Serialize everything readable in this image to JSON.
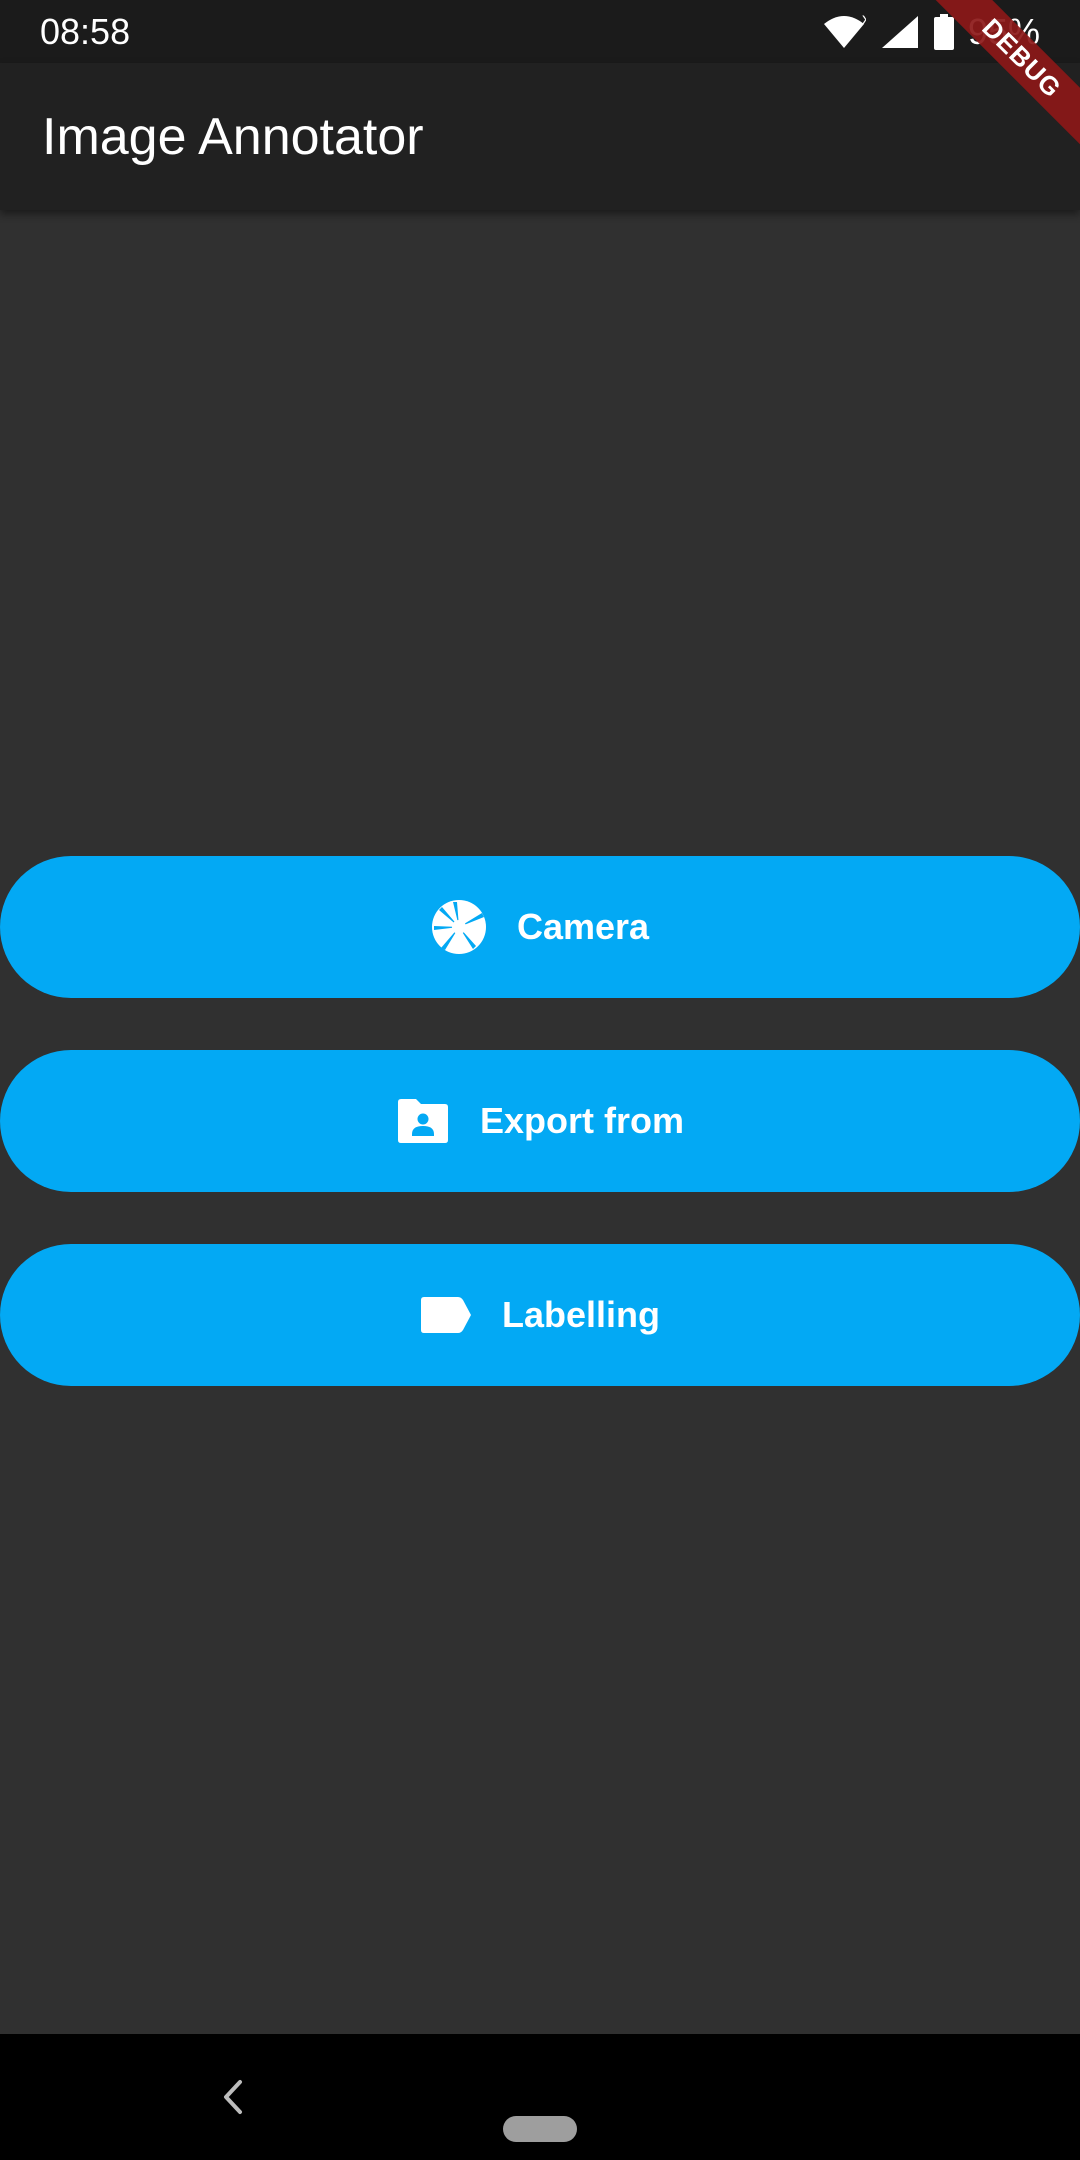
{
  "status_bar": {
    "time": "08:58",
    "battery_percent": "95%",
    "icons": [
      "wifi-icon",
      "signal-icon",
      "battery-icon"
    ]
  },
  "app_bar": {
    "title": "Image Annotator"
  },
  "debug_banner": {
    "text": "DEBUG"
  },
  "buttons": [
    {
      "label": "Camera",
      "icon": "camera-shutter-icon"
    },
    {
      "label": "Export from",
      "icon": "folder-user-icon"
    },
    {
      "label": "Labelling",
      "icon": "label-tag-icon"
    }
  ],
  "nav_bar": {
    "icons": [
      "back-icon",
      "home-pill-icon"
    ]
  },
  "colors": {
    "background": "#303030",
    "app_bar": "#212121",
    "status_bar": "#1b1b1b",
    "accent": "#03a9f4",
    "debug_ribbon": "#8c1818"
  }
}
